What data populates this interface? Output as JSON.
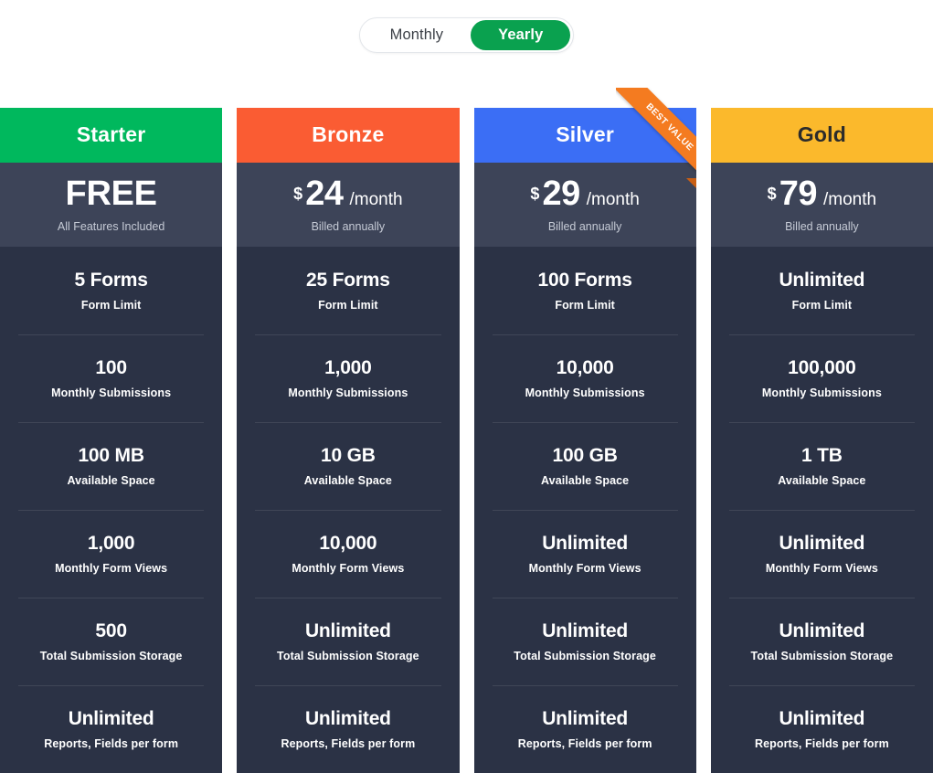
{
  "billing_toggle": {
    "name": "billing-period-toggle",
    "options": [
      {
        "label": "Monthly",
        "active": false
      },
      {
        "label": "Yearly",
        "active": true
      }
    ],
    "active_color": "#0aa14f"
  },
  "feature_labels": [
    "Form Limit",
    "Monthly Submissions",
    "Available Space",
    "Monthly Form Views",
    "Total Submission Storage",
    "Reports, Fields per form"
  ],
  "plans": [
    {
      "name": "Starter",
      "header_color": "#00b85d",
      "header_text_color": "#ffffff",
      "price_type": "free",
      "price_free_label": "FREE",
      "price_currency": "$",
      "price_amount": "",
      "price_period": "",
      "price_sub": "All Features Included",
      "badge": null,
      "features": [
        {
          "value": "5 Forms",
          "label": "Form Limit"
        },
        {
          "value": "100",
          "label": "Monthly Submissions"
        },
        {
          "value": "100 MB",
          "label": "Available Space"
        },
        {
          "value": "1,000",
          "label": "Monthly Form Views"
        },
        {
          "value": "500",
          "label": "Total Submission Storage"
        },
        {
          "value": "Unlimited",
          "label": "Reports, Fields per form"
        }
      ]
    },
    {
      "name": "Bronze",
      "header_color": "#fa5c33",
      "header_text_color": "#ffffff",
      "price_type": "paid",
      "price_free_label": "",
      "price_currency": "$",
      "price_amount": "24",
      "price_period": "/month",
      "price_sub": "Billed annually",
      "badge": null,
      "features": [
        {
          "value": "25 Forms",
          "label": "Form Limit"
        },
        {
          "value": "1,000",
          "label": "Monthly Submissions"
        },
        {
          "value": "10 GB",
          "label": "Available Space"
        },
        {
          "value": "10,000",
          "label": "Monthly Form Views"
        },
        {
          "value": "Unlimited",
          "label": "Total Submission Storage"
        },
        {
          "value": "Unlimited",
          "label": "Reports, Fields per form"
        }
      ]
    },
    {
      "name": "Silver",
      "header_color": "#3b6ef5",
      "header_text_color": "#ffffff",
      "price_type": "paid",
      "price_free_label": "",
      "price_currency": "$",
      "price_amount": "29",
      "price_period": "/month",
      "price_sub": "Billed annually",
      "badge": {
        "text": "BEST VALUE",
        "color": "#f47b20",
        "shadow_color": "#c95f14"
      },
      "features": [
        {
          "value": "100 Forms",
          "label": "Form Limit"
        },
        {
          "value": "10,000",
          "label": "Monthly Submissions"
        },
        {
          "value": "100 GB",
          "label": "Available Space"
        },
        {
          "value": "Unlimited",
          "label": "Monthly Form Views"
        },
        {
          "value": "Unlimited",
          "label": "Total Submission Storage"
        },
        {
          "value": "Unlimited",
          "label": "Reports, Fields per form"
        }
      ]
    },
    {
      "name": "Gold",
      "header_color": "#fbb92c",
      "header_text_color": "#2b2b2b",
      "price_type": "paid",
      "price_free_label": "",
      "price_currency": "$",
      "price_amount": "79",
      "price_period": "/month",
      "price_sub": "Billed annually",
      "badge": null,
      "features": [
        {
          "value": "Unlimited",
          "label": "Form Limit"
        },
        {
          "value": "100,000",
          "label": "Monthly Submissions"
        },
        {
          "value": "1 TB",
          "label": "Available Space"
        },
        {
          "value": "Unlimited",
          "label": "Monthly Form Views"
        },
        {
          "value": "Unlimited",
          "label": "Total Submission Storage"
        },
        {
          "value": "Unlimited",
          "label": "Reports, Fields per form"
        }
      ]
    }
  ],
  "theme": {
    "page_background": "#ffffff",
    "card_body_color": "#2b3245",
    "price_block_color": "#3d4458",
    "divider_color": "rgba(255,255,255,0.10)"
  }
}
